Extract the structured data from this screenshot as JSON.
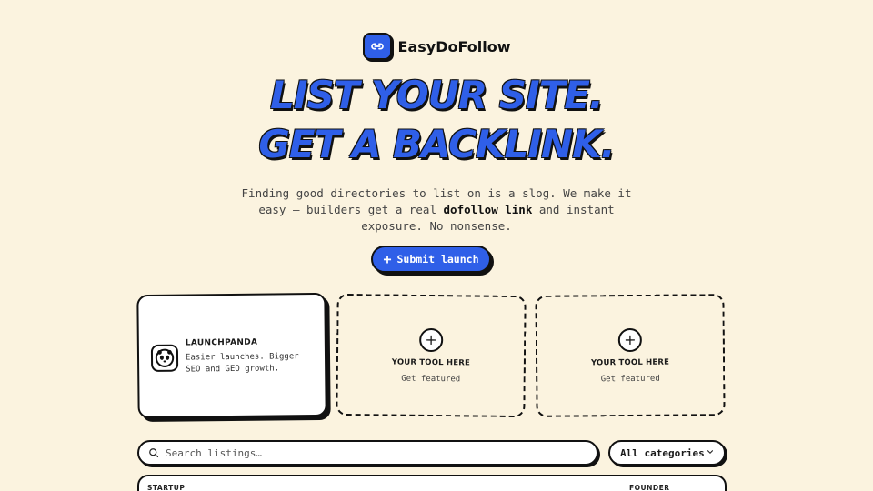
{
  "brand": {
    "name": "EasyDoFollow",
    "logo_icon": "link-icon"
  },
  "hero": {
    "line1": "LIST YOUR SITE.",
    "line2": "GET A BACKLINK."
  },
  "subtitle": {
    "before": "Finding good directories to list on is a slog. We make it easy — builders get a real ",
    "highlight": "dofollow link",
    "after": " and instant exposure. No nonsense."
  },
  "submit_button": {
    "label": "Submit launch"
  },
  "featured": {
    "title": "LAUNCHPANDA",
    "description": "Easier launches. Bigger SEO and GEO growth.",
    "icon": "panda-icon"
  },
  "placeholders": [
    {
      "title": "YOUR TOOL HERE",
      "subtitle": "Get featured"
    },
    {
      "title": "YOUR TOOL HERE",
      "subtitle": "Get featured"
    }
  ],
  "search": {
    "placeholder": "Search listings…"
  },
  "category_select": {
    "value": "All categories"
  },
  "table": {
    "columns": [
      "STARTUP",
      "FOUNDER"
    ]
  },
  "colors": {
    "background": "#fbf3df",
    "accent": "#2f5fe8",
    "ink": "#111111"
  }
}
